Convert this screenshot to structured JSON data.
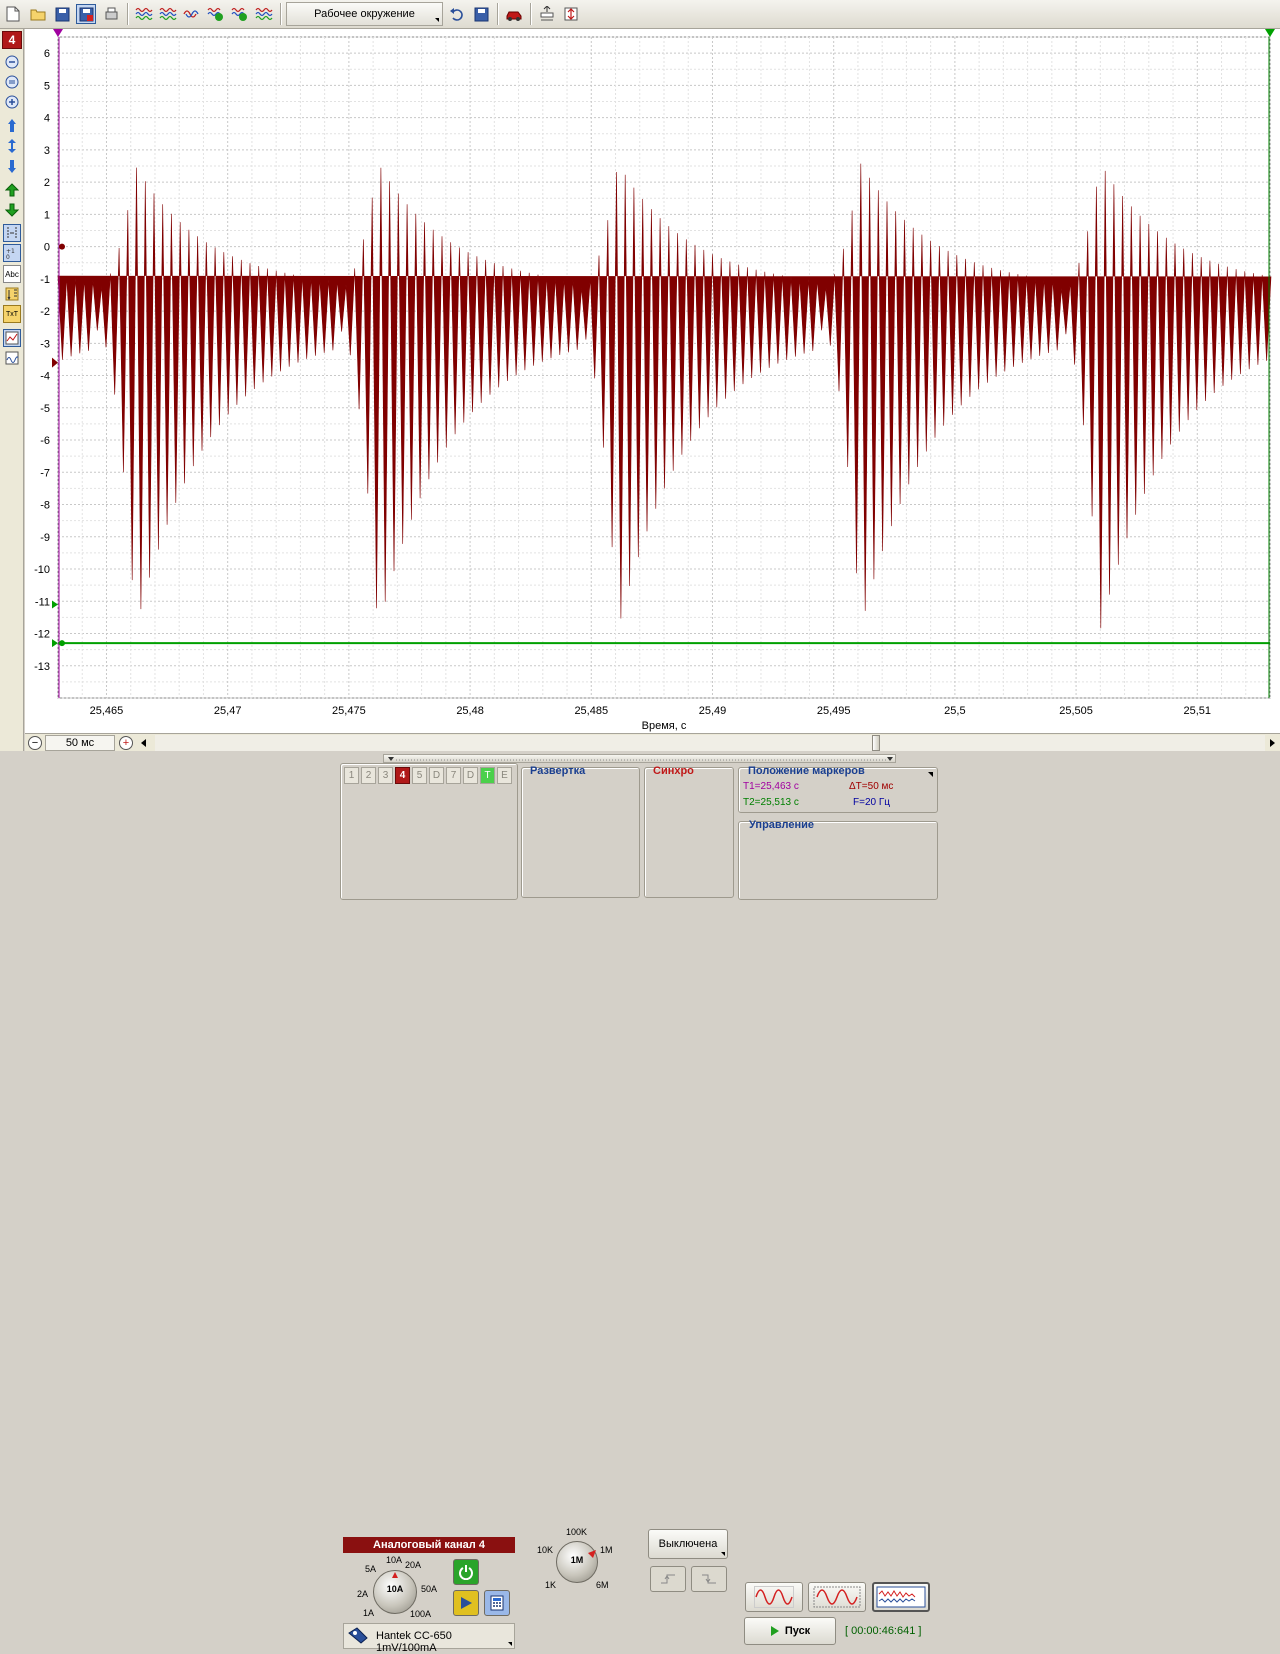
{
  "toolbar": {
    "workspace_label": "Рабочее окружение"
  },
  "left_toolbar": {
    "channel_badge": "4",
    "abc_label": "Abc",
    "tt_label": "TxT"
  },
  "chart_data": {
    "type": "line",
    "xlabel": "Время, с",
    "ylabel": "",
    "x_ticks": [
      "25,465",
      "25,47",
      "25,475",
      "25,48",
      "25,485",
      "25,49",
      "25,495",
      "25,5",
      "25,505",
      "25,51"
    ],
    "x_tick_values": [
      25.465,
      25.47,
      25.475,
      25.48,
      25.485,
      25.49,
      25.495,
      25.5,
      25.505,
      25.51
    ],
    "xlim": [
      25.463,
      25.513
    ],
    "y_ticks": [
      "6",
      "5",
      "4",
      "3",
      "2",
      "1",
      "0",
      "-1",
      "-2",
      "-3",
      "-4",
      "-5",
      "-6",
      "-7",
      "-8",
      "-9",
      "-10",
      "-11",
      "-12",
      "-13"
    ],
    "y_tick_values": [
      6,
      5,
      4,
      3,
      2,
      1,
      0,
      -1,
      -2,
      -3,
      -4,
      -5,
      -6,
      -7,
      -8,
      -9,
      -10,
      -11,
      -12,
      -13
    ],
    "ylim": [
      -14,
      6.5
    ],
    "grid": true,
    "series": [
      {
        "color": "#800000",
        "envelope_peaks": [
          {
            "x": 25.4662,
            "upper": 2.5,
            "lower": -11.9
          },
          {
            "x": 25.4762,
            "upper": 2.6,
            "lower": -11.9
          },
          {
            "x": 25.4861,
            "upper": 2.6,
            "lower": -11.9
          },
          {
            "x": 25.4961,
            "upper": 2.6,
            "lower": -11.9
          },
          {
            "x": 25.506,
            "upper": 2.6,
            "lower": -11.9
          }
        ],
        "baseline_upper": -1.3,
        "baseline_lower": -2.6,
        "cycle_period": 0.01
      }
    ],
    "markers": {
      "level_line": -12.3,
      "level_color": "#00a000"
    }
  },
  "hscroll": {
    "zoom_value": "50 мс"
  },
  "channel_panel": {
    "tabs": [
      "1",
      "2",
      "3",
      "4",
      "5",
      "D",
      "7",
      "D",
      "T",
      "E"
    ],
    "header": "Аналоговый канал 4",
    "knob_labels": [
      "10A",
      "5A",
      "20A",
      "2A",
      "50A",
      "1A",
      "100A"
    ],
    "knob_value": "10A",
    "probe": "Hantek CC-650 1mV/100mA"
  },
  "sweep_panel": {
    "title": "Развертка",
    "knob_labels": [
      "100K",
      "10K",
      "1M",
      "1K",
      "6M"
    ],
    "knob_value": "1M"
  },
  "sync_panel": {
    "title": "Синхро",
    "state": "Выключена"
  },
  "markers_panel": {
    "title": "Положение маркеров",
    "t1": "T1=25,463 c",
    "t2": "T2=25,513 c",
    "dt": "ΔT=50 мс",
    "f": "F=20 Гц",
    "colors": {
      "t1": "#a000a0",
      "t2": "#008000",
      "dt": "#a00000",
      "f": "#0000a0"
    }
  },
  "control_panel": {
    "title": "Управление",
    "start": "Пуск",
    "timer": "[ 00:00:46:641 ]"
  }
}
